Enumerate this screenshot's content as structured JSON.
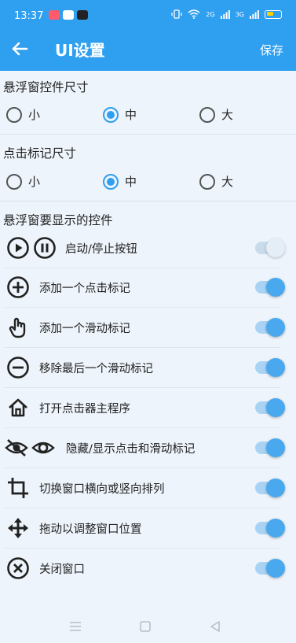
{
  "status": {
    "time": "13:37",
    "signal_left": "2G",
    "signal_right": "3G"
  },
  "appbar": {
    "title": "UI设置",
    "save_label": "保存"
  },
  "size_section": {
    "title": "悬浮窗控件尺寸",
    "options": [
      {
        "label": "小",
        "selected": false
      },
      {
        "label": "中",
        "selected": true
      },
      {
        "label": "大",
        "selected": false
      }
    ]
  },
  "mark_section": {
    "title": "点击标记尺寸",
    "options": [
      {
        "label": "小",
        "selected": false
      },
      {
        "label": "中",
        "selected": true
      },
      {
        "label": "大",
        "selected": false
      }
    ]
  },
  "controls_section": {
    "title": "悬浮窗要显示的控件",
    "items": [
      {
        "label": "启动/停止按钮",
        "icon": "play-pause-icon",
        "enabled": false
      },
      {
        "label": "添加一个点击标记",
        "icon": "add-circle-icon",
        "enabled": true
      },
      {
        "label": "添加一个滑动标记",
        "icon": "swipe-hand-icon",
        "enabled": true
      },
      {
        "label": "移除最后一个滑动标记",
        "icon": "remove-circle-icon",
        "enabled": true
      },
      {
        "label": "打开点击器主程序",
        "icon": "home-icon",
        "enabled": true
      },
      {
        "label": "隐藏/显示点击和滑动标记",
        "icon": "visibility-icon",
        "enabled": true
      },
      {
        "label": "切换窗口横向或竖向排列",
        "icon": "crop-rotate-icon",
        "enabled": true
      },
      {
        "label": "拖动以调整窗口位置",
        "icon": "move-arrows-icon",
        "enabled": true
      },
      {
        "label": "关闭窗口",
        "icon": "close-circle-icon",
        "enabled": true
      }
    ]
  },
  "colors": {
    "primary": "#2f9ff0",
    "background": "#eef4fb",
    "toggle_on": "#4aa9ee"
  }
}
